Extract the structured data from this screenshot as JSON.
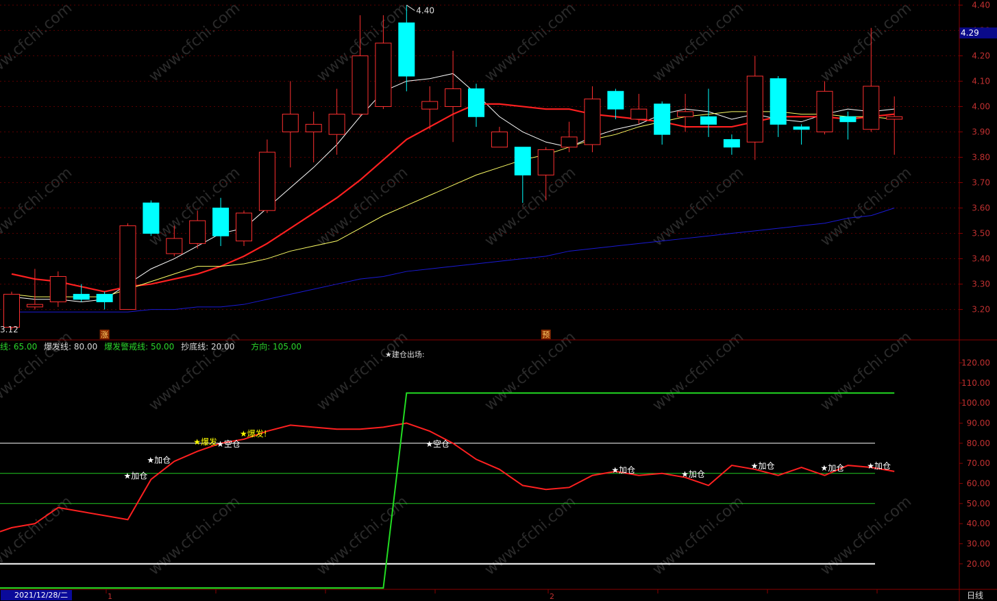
{
  "chart_data": [
    {
      "type": "candlestick",
      "panel": "main",
      "ylim": [
        3.08,
        4.42
      ],
      "y_ticks": [
        "3.20",
        "3.30",
        "3.40",
        "3.50",
        "3.60",
        "3.70",
        "3.80",
        "3.90",
        "4.00",
        "4.10",
        "4.20",
        "4.30",
        "4.40"
      ],
      "current_price_label": "4.29",
      "max_label": "4.40",
      "min_label": "3.12",
      "candles": [
        {
          "o": 3.13,
          "c": 3.26,
          "h": 3.27,
          "l": 3.12
        },
        {
          "o": 3.21,
          "c": 3.22,
          "h": 3.36,
          "l": 3.2
        },
        {
          "o": 3.23,
          "c": 3.33,
          "h": 3.35,
          "l": 3.21
        },
        {
          "o": 3.26,
          "c": 3.24,
          "h": 3.3,
          "l": 3.23
        },
        {
          "o": 3.26,
          "c": 3.23,
          "h": 3.27,
          "l": 3.2
        },
        {
          "o": 3.2,
          "c": 3.53,
          "h": 3.54,
          "l": 3.2
        },
        {
          "o": 3.62,
          "c": 3.5,
          "h": 3.63,
          "l": 3.49
        },
        {
          "o": 3.42,
          "c": 3.48,
          "h": 3.53,
          "l": 3.41
        },
        {
          "o": 3.46,
          "c": 3.55,
          "h": 3.59,
          "l": 3.44
        },
        {
          "o": 3.6,
          "c": 3.49,
          "h": 3.64,
          "l": 3.45
        },
        {
          "o": 3.47,
          "c": 3.58,
          "h": 3.59,
          "l": 3.45
        },
        {
          "o": 3.59,
          "c": 3.82,
          "h": 3.87,
          "l": 3.58
        },
        {
          "o": 3.9,
          "c": 3.97,
          "h": 4.1,
          "l": 3.76
        },
        {
          "o": 3.9,
          "c": 3.93,
          "h": 3.98,
          "l": 3.78
        },
        {
          "o": 3.89,
          "c": 3.97,
          "h": 4.07,
          "l": 3.81
        },
        {
          "o": 3.97,
          "c": 4.2,
          "h": 4.36,
          "l": 3.96
        },
        {
          "o": 4.0,
          "c": 4.25,
          "h": 4.36,
          "l": 3.99
        },
        {
          "o": 4.33,
          "c": 4.12,
          "h": 4.4,
          "l": 4.06
        },
        {
          "o": 3.99,
          "c": 4.02,
          "h": 4.08,
          "l": 3.91
        },
        {
          "o": 4.0,
          "c": 4.07,
          "h": 4.22,
          "l": 3.86
        },
        {
          "o": 4.07,
          "c": 3.96,
          "h": 4.09,
          "l": 3.92
        },
        {
          "o": 3.84,
          "c": 3.9,
          "h": 3.92,
          "l": 3.84
        },
        {
          "o": 3.84,
          "c": 3.73,
          "h": 3.84,
          "l": 3.62
        },
        {
          "o": 3.73,
          "c": 3.83,
          "h": 3.84,
          "l": 3.63
        },
        {
          "o": 3.84,
          "c": 3.88,
          "h": 3.94,
          "l": 3.82
        },
        {
          "o": 3.85,
          "c": 4.03,
          "h": 4.08,
          "l": 3.82
        },
        {
          "o": 4.06,
          "c": 3.99,
          "h": 4.07,
          "l": 3.95
        },
        {
          "o": 3.95,
          "c": 3.99,
          "h": 4.05,
          "l": 3.93
        },
        {
          "o": 4.01,
          "c": 3.89,
          "h": 4.02,
          "l": 3.85
        },
        {
          "o": 3.96,
          "c": 3.98,
          "h": 4.05,
          "l": 3.9
        },
        {
          "o": 3.96,
          "c": 3.93,
          "h": 4.07,
          "l": 3.88
        },
        {
          "o": 3.87,
          "c": 3.84,
          "h": 3.89,
          "l": 3.81
        },
        {
          "o": 3.86,
          "c": 4.12,
          "h": 4.2,
          "l": 3.79
        },
        {
          "o": 4.11,
          "c": 3.93,
          "h": 4.12,
          "l": 3.88
        },
        {
          "o": 3.92,
          "c": 3.91,
          "h": 3.93,
          "l": 3.85
        },
        {
          "o": 3.9,
          "c": 4.06,
          "h": 4.1,
          "l": 3.89
        },
        {
          "o": 3.96,
          "c": 3.94,
          "h": 3.98,
          "l": 3.87
        },
        {
          "o": 3.91,
          "c": 4.08,
          "h": 4.31,
          "l": 3.9
        },
        {
          "o": 3.95,
          "c": 3.96,
          "h": 4.04,
          "l": 3.81
        }
      ],
      "series": [
        {
          "color": "#ffffff",
          "values": [
            3.25,
            3.24,
            3.24,
            3.23,
            3.24,
            3.3,
            3.36,
            3.4,
            3.45,
            3.5,
            3.52,
            3.6,
            3.68,
            3.76,
            3.85,
            3.96,
            4.06,
            4.1,
            4.11,
            4.13,
            4.05,
            3.96,
            3.9,
            3.86,
            3.84,
            3.88,
            3.91,
            3.93,
            3.97,
            3.99,
            3.98,
            3.95,
            3.97,
            3.95,
            3.94,
            3.97,
            3.99,
            3.98,
            3.99
          ]
        },
        {
          "color": "#ff2020",
          "values": [
            3.34,
            3.32,
            3.31,
            3.29,
            3.27,
            3.29,
            3.3,
            3.32,
            3.34,
            3.37,
            3.41,
            3.46,
            3.52,
            3.58,
            3.64,
            3.71,
            3.79,
            3.87,
            3.92,
            3.97,
            4.01,
            4.01,
            4.0,
            3.99,
            3.99,
            3.97,
            3.96,
            3.95,
            3.94,
            3.92,
            3.92,
            3.92,
            3.94,
            3.96,
            3.96,
            3.96,
            3.95,
            3.96,
            3.97
          ]
        },
        {
          "color": "#ffff66",
          "values": [
            3.26,
            3.25,
            3.25,
            3.25,
            3.25,
            3.28,
            3.31,
            3.34,
            3.37,
            3.37,
            3.38,
            3.4,
            3.43,
            3.45,
            3.47,
            3.52,
            3.57,
            3.61,
            3.65,
            3.69,
            3.73,
            3.76,
            3.79,
            3.81,
            3.84,
            3.87,
            3.89,
            3.92,
            3.94,
            3.96,
            3.97,
            3.98,
            3.98,
            3.98,
            3.97,
            3.97,
            3.96,
            3.96,
            3.95
          ]
        },
        {
          "color": "#1a1ad6",
          "values": [
            3.19,
            3.19,
            3.19,
            3.19,
            3.19,
            3.19,
            3.2,
            3.2,
            3.21,
            3.21,
            3.22,
            3.24,
            3.26,
            3.28,
            3.3,
            3.32,
            3.33,
            3.35,
            3.36,
            3.37,
            3.38,
            3.39,
            3.4,
            3.41,
            3.43,
            3.44,
            3.45,
            3.46,
            3.47,
            3.48,
            3.49,
            3.5,
            3.51,
            3.52,
            3.53,
            3.54,
            3.56,
            3.57,
            3.6
          ]
        }
      ],
      "markers": [
        {
          "index": 4,
          "text": "涨"
        },
        {
          "index": 23,
          "text": "预"
        }
      ]
    },
    {
      "type": "line",
      "panel": "indicator",
      "ylim": [
        8,
        128
      ],
      "y_ticks": [
        "20.00",
        "30.00",
        "40.00",
        "50.00",
        "60.00",
        "70.00",
        "80.00",
        "90.00",
        "100.00",
        "110.00",
        "120.00"
      ],
      "legend": [
        {
          "label": "线: 65.00",
          "color": "#2bd52b"
        },
        {
          "label": "爆发线: 80.00",
          "color": "#d8d8d8"
        },
        {
          "label": "爆发警戒线: 50.00",
          "color": "#2bd52b"
        },
        {
          "label": "抄底线: 20.00",
          "color": "#d8d8d8"
        },
        {
          "label": "方向: 105.00",
          "color": "#2bd52b"
        }
      ],
      "top_note": "★建仓出场:",
      "hlines": [
        {
          "value": 80,
          "color": "#ffffff"
        },
        {
          "value": 65,
          "color": "#22cc22"
        },
        {
          "value": 50,
          "color": "#22cc22"
        },
        {
          "value": 20,
          "color": "#ffffff"
        }
      ],
      "series": [
        {
          "name": "",
          "color": "#ff2020",
          "values": [
            38,
            40,
            48,
            46,
            44,
            42,
            62,
            71,
            76,
            80,
            82,
            86,
            89,
            88,
            87,
            87,
            88,
            90,
            86,
            80,
            72,
            67,
            59,
            57,
            58,
            64,
            66,
            64,
            65,
            63,
            59,
            69,
            67,
            64,
            68,
            64,
            69,
            68,
            66
          ]
        },
        {
          "name": "",
          "color": "#22dd22",
          "values": [
            8,
            8,
            8,
            8,
            8,
            8,
            8,
            8,
            8,
            8,
            8,
            8,
            8,
            8,
            8,
            8,
            8,
            105,
            105,
            105,
            105,
            105,
            105,
            105,
            105,
            105,
            105,
            105,
            105,
            105,
            105,
            105,
            105,
            105,
            105,
            105,
            105,
            105,
            105
          ]
        }
      ],
      "annotations": [
        {
          "index": 5,
          "value": 64,
          "text": "★加仓",
          "color": "#ffffff"
        },
        {
          "index": 6,
          "value": 72,
          "text": "★加仓",
          "color": "#ffffff"
        },
        {
          "index": 8,
          "value": 81,
          "text": "★爆发",
          "color": "#ffff00"
        },
        {
          "index": 9,
          "value": 80,
          "text": "★空仓",
          "color": "#ffffff"
        },
        {
          "index": 10,
          "value": 85,
          "text": "★爆发!",
          "color": "#ffff00"
        },
        {
          "index": 18,
          "value": 80,
          "text": "★空仓",
          "color": "#ffffff"
        },
        {
          "index": 26,
          "value": 67,
          "text": "★加仓",
          "color": "#ffffff"
        },
        {
          "index": 29,
          "value": 65,
          "text": "★加仓",
          "color": "#ffffff"
        },
        {
          "index": 32,
          "value": 69,
          "text": "★加仓",
          "color": "#ffffff"
        },
        {
          "index": 35,
          "value": 68,
          "text": "★加仓",
          "color": "#ffffff"
        },
        {
          "index": 37,
          "value": 69,
          "text": "★加仓",
          "color": "#ffffff"
        }
      ]
    }
  ],
  "footer": {
    "date": "2021/12/28/二",
    "month_marks": [
      "1",
      "2"
    ],
    "period": "日线"
  },
  "watermark": "www.cfchi.com",
  "colors": {
    "bull": "#ff3030",
    "bear": "#00ffff",
    "grid": "#5a0000",
    "axis": "#8a0000"
  }
}
